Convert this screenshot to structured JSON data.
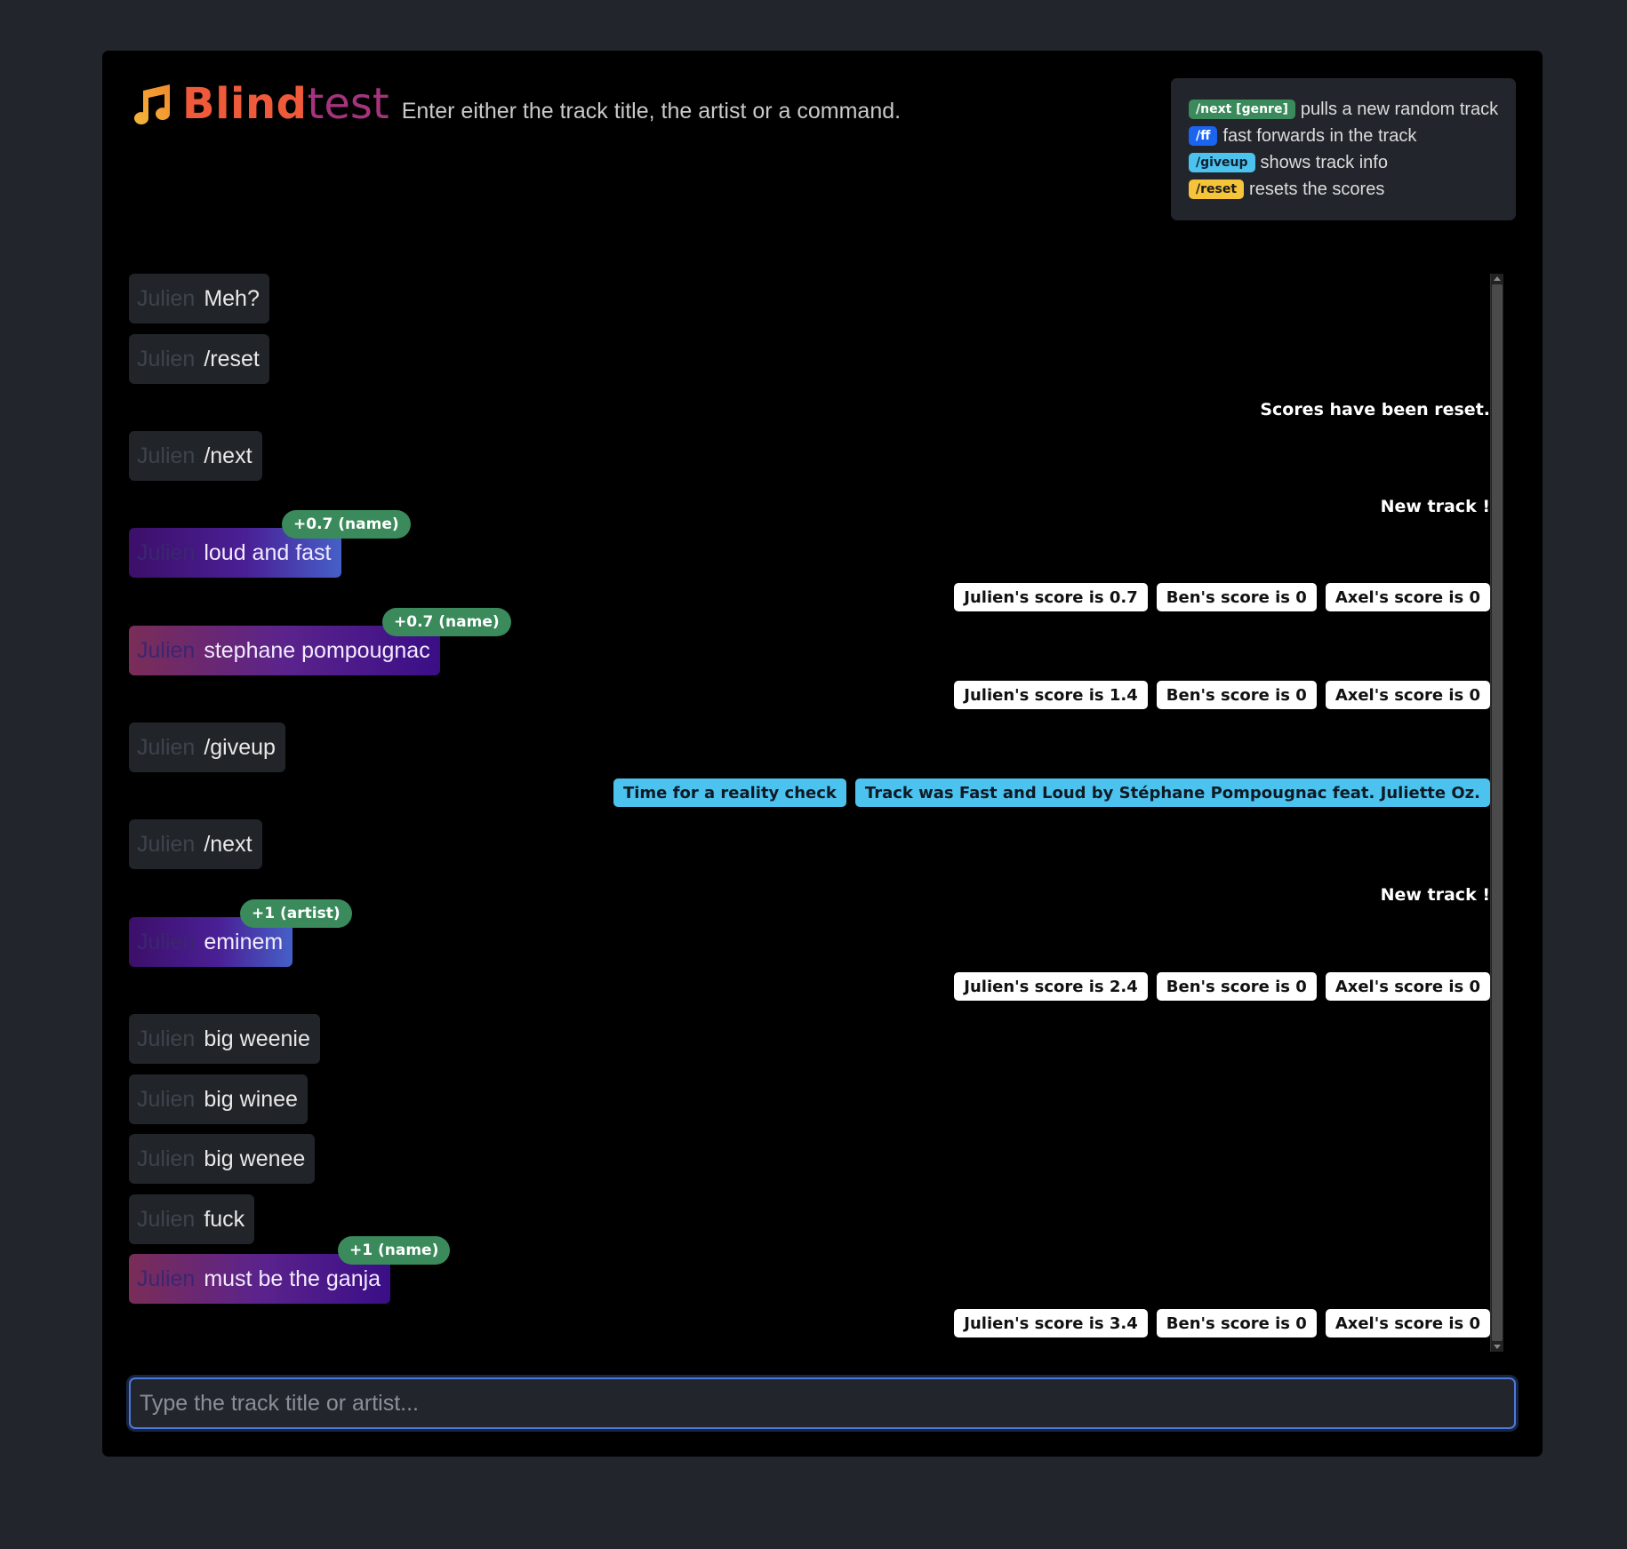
{
  "header": {
    "title_bold": "Blind",
    "title_light": "test",
    "subtitle": "Enter either the track title, the artist or a command.",
    "logo_icon": "music-note-icon"
  },
  "help": [
    {
      "command": "/next [genre]",
      "desc": "pulls a new random track",
      "color": "#3b8a5c"
    },
    {
      "command": "/ff",
      "desc": "fast forwards in the track",
      "color": "#1b64f0"
    },
    {
      "command": "/giveup",
      "desc": "shows track info",
      "color": "#4cc3ef"
    },
    {
      "command": "/reset",
      "desc": "resets the scores",
      "color": "#f6c43a"
    }
  ],
  "chat": [
    {
      "type": "message",
      "user": "Julien",
      "text": "Meh?"
    },
    {
      "type": "message",
      "user": "Julien",
      "text": "/reset"
    },
    {
      "type": "system",
      "text": "Scores have been reset."
    },
    {
      "type": "message",
      "user": "Julien",
      "text": "/next"
    },
    {
      "type": "system",
      "text": "New track !"
    },
    {
      "type": "message",
      "user": "Julien",
      "text": "loud and fast",
      "points": "+0.7 (name)"
    },
    {
      "type": "scores",
      "items": [
        "Julien's score is 0.7",
        "Ben's score is 0",
        "Axel's score is 0"
      ]
    },
    {
      "type": "message",
      "user": "Julien",
      "text": "stephane pompougnac",
      "points": "+0.7 (name)"
    },
    {
      "type": "scores",
      "items": [
        "Julien's score is 1.4",
        "Ben's score is 0",
        "Axel's score is 0"
      ]
    },
    {
      "type": "message",
      "user": "Julien",
      "text": "/giveup"
    },
    {
      "type": "info",
      "items": [
        "Time for a reality check",
        "Track was Fast and Loud by Stéphane Pompougnac feat. Juliette Oz."
      ]
    },
    {
      "type": "message",
      "user": "Julien",
      "text": "/next"
    },
    {
      "type": "system",
      "text": "New track !"
    },
    {
      "type": "message",
      "user": "Julien",
      "text": "eminem",
      "points": "+1 (artist)"
    },
    {
      "type": "scores",
      "items": [
        "Julien's score is 2.4",
        "Ben's score is 0",
        "Axel's score is 0"
      ]
    },
    {
      "type": "message",
      "user": "Julien",
      "text": "big weenie"
    },
    {
      "type": "message",
      "user": "Julien",
      "text": "big winee"
    },
    {
      "type": "message",
      "user": "Julien",
      "text": "big wenee"
    },
    {
      "type": "message",
      "user": "Julien",
      "text": "fuck"
    },
    {
      "type": "message",
      "user": "Julien",
      "text": "must be the ganja",
      "points": "+1 (name)"
    },
    {
      "type": "scores",
      "items": [
        "Julien's score is 3.4",
        "Ben's score is 0",
        "Axel's score is 0"
      ]
    }
  ],
  "input": {
    "placeholder": "Type the track title or artist...",
    "value": ""
  },
  "colors": {
    "background": "#22252b",
    "panel": "#000000",
    "accent_orange": "#ee5a3a",
    "accent_purple": "#a5347d",
    "points_green": "#3a8a5b",
    "info_cyan": "#4cc3ef"
  }
}
